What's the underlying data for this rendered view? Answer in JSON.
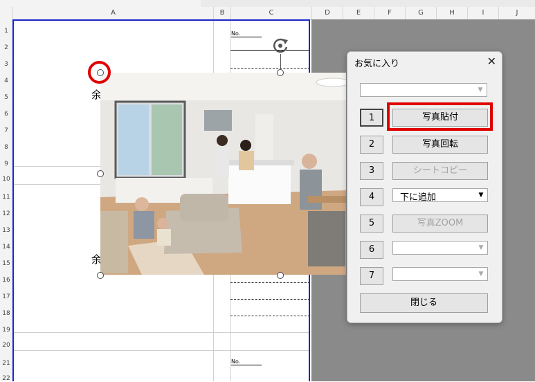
{
  "sheet": {
    "columns": [
      "A",
      "B",
      "C",
      "D",
      "E",
      "F",
      "G",
      "H",
      "I",
      "J"
    ],
    "rows": [
      "1",
      "2",
      "3",
      "4",
      "5",
      "6",
      "7",
      "8",
      "9",
      "10",
      "11",
      "12",
      "13",
      "14",
      "15",
      "16",
      "17",
      "18",
      "19",
      "20",
      "21",
      "22"
    ],
    "cell_label_top": "No.",
    "cell_label_bottom": "No.",
    "char_row4": "余",
    "char_row15": "余"
  },
  "photo": {
    "description_icon": "family-living-room-photo"
  },
  "dialog": {
    "title": "お気に入り",
    "close_label": "✕",
    "top_combo_value": "",
    "rows": [
      {
        "num": "1",
        "action": "写真貼付",
        "type": "button",
        "enabled": true
      },
      {
        "num": "2",
        "action": "写真回転",
        "type": "button",
        "enabled": true
      },
      {
        "num": "3",
        "action": "シートコピー",
        "type": "button",
        "enabled": false
      },
      {
        "num": "4",
        "action": "下に追加",
        "type": "combo",
        "enabled": true
      },
      {
        "num": "5",
        "action": "写真ZOOM",
        "type": "button",
        "enabled": false
      },
      {
        "num": "6",
        "action": "",
        "type": "combo",
        "enabled": false
      },
      {
        "num": "7",
        "action": "",
        "type": "combo",
        "enabled": false
      }
    ],
    "close_button": "閉じる"
  },
  "colors": {
    "print_border": "#1a27c9",
    "highlight": "#e00000"
  }
}
